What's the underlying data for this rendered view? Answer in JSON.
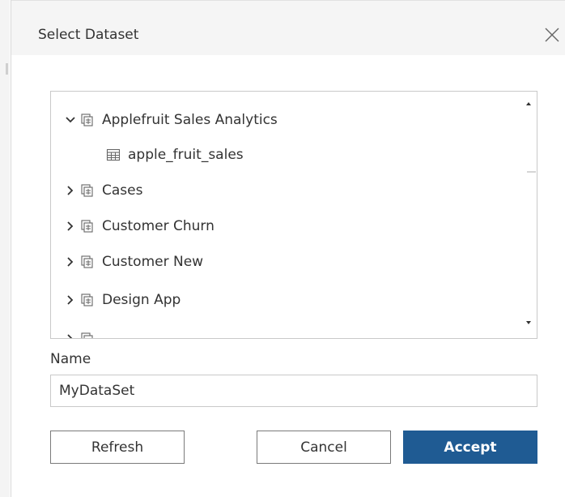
{
  "dialog": {
    "title": "Select Dataset",
    "close_icon": "close-icon"
  },
  "tree": {
    "items": [
      {
        "label": "Applefruit Sales Analytics",
        "type": "dataset",
        "expanded": true,
        "icon": "dataset-icon"
      },
      {
        "label": "apple_fruit_sales",
        "type": "table",
        "icon": "table-icon"
      },
      {
        "label": "Cases",
        "type": "dataset",
        "expanded": false,
        "icon": "dataset-icon"
      },
      {
        "label": "Customer Churn",
        "type": "dataset",
        "expanded": false,
        "icon": "dataset-icon"
      },
      {
        "label": "Customer New",
        "type": "dataset",
        "expanded": false,
        "icon": "dataset-icon"
      },
      {
        "label": "Design App",
        "type": "dataset",
        "expanded": false,
        "icon": "dataset-icon"
      }
    ]
  },
  "name_field": {
    "label": "Name",
    "value": "MyDataSet"
  },
  "buttons": {
    "refresh": "Refresh",
    "cancel": "Cancel",
    "accept": "Accept"
  },
  "colors": {
    "accent": "#1f5b93",
    "header_bg": "#f5f5f5",
    "border": "#c9c9c9"
  }
}
